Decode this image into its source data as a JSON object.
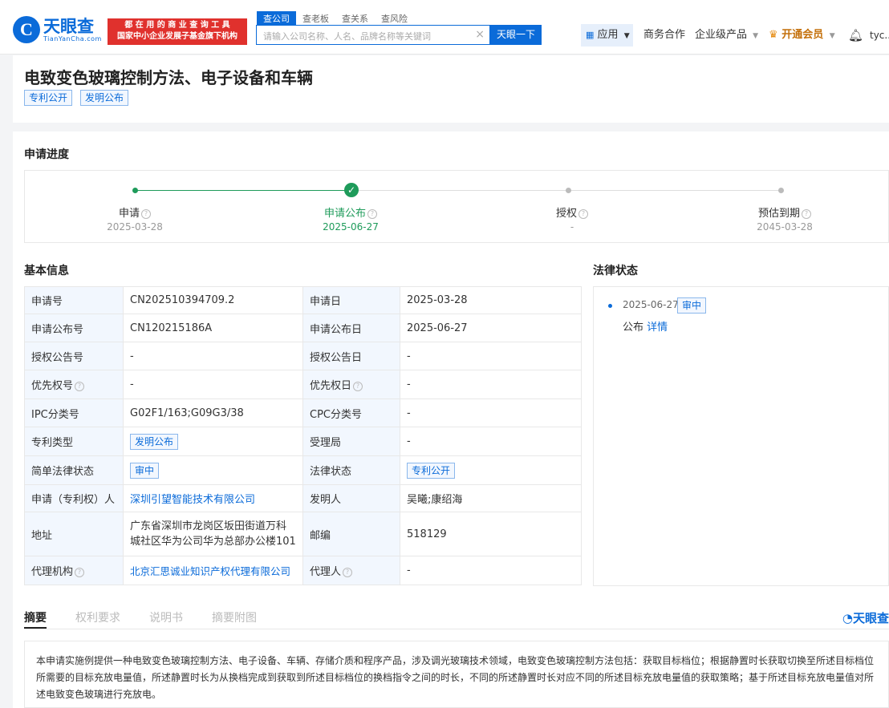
{
  "header": {
    "logo_glyph": "C",
    "logo_cn": "天眼查",
    "logo_en": "TianYanCha.com",
    "banner_line1": "都 在 用 的 商 业 查 询 工 具",
    "banner_line2": "国家中小企业发展子基金旗下机构",
    "search_tabs": [
      "查公司",
      "查老板",
      "查关系",
      "查风险"
    ],
    "search_placeholder": "请输入公司名称、人名、品牌名称等关键词",
    "search_clear": "×",
    "search_button": "天眼一下",
    "nav_app": "应用",
    "nav_biz": "商务合作",
    "nav_ent": "企业级产品",
    "nav_vip": "开通会员",
    "nav_user": "tyc..."
  },
  "patent": {
    "title": "电致变色玻璃控制方法、电子设备和车辆",
    "tags": [
      "专利公开",
      "发明公布"
    ]
  },
  "progress": {
    "title": "申请进度",
    "steps": [
      {
        "label": "申请",
        "date": "2025-03-28"
      },
      {
        "label": "申请公布",
        "date": "2025-06-27"
      },
      {
        "label": "授权",
        "date": "-"
      },
      {
        "label": "预估到期",
        "date": "2045-03-28"
      }
    ]
  },
  "basic": {
    "title": "基本信息",
    "rows": [
      {
        "k1": "申请号",
        "v1": "CN202510394709.2",
        "k2": "申请日",
        "v2": "2025-03-28"
      },
      {
        "k1": "申请公布号",
        "v1": "CN120215186A",
        "k2": "申请公布日",
        "v2": "2025-06-27"
      },
      {
        "k1": "授权公告号",
        "v1": "-",
        "k2": "授权公告日",
        "v2": "-"
      },
      {
        "k1": "优先权号",
        "v1": "-",
        "k2": "优先权日",
        "v2": "-"
      },
      {
        "k1": "IPC分类号",
        "v1": "G02F1/163;G09G3/38",
        "k2": "CPC分类号",
        "v2": "-"
      },
      {
        "k1": "专利类型",
        "v1": "发明公布",
        "k2": "受理局",
        "v2": "-"
      },
      {
        "k1": "简单法律状态",
        "v1": "审中",
        "k2": "法律状态",
        "v2": "专利公开"
      },
      {
        "k1": "申请（专利权）人",
        "v1": "深圳引望智能技术有限公司",
        "k2": "发明人",
        "v2": "吴曦;康绍海"
      },
      {
        "k1": "地址",
        "v1": "广东省深圳市龙岗区坂田街道万科城社区华为公司华为总部办公楼101",
        "k2": "邮编",
        "v2": "518129"
      },
      {
        "k1": "代理机构",
        "v1": "北京汇思诚业知识产权代理有限公司",
        "k2": "代理人",
        "v2": "-"
      }
    ]
  },
  "legal": {
    "title": "法律状态",
    "date": "2025-06-27",
    "tag": "审中",
    "desc": "公布",
    "link": "详情"
  },
  "tabs": [
    "摘要",
    "权利要求",
    "说明书",
    "摘要附图"
  ],
  "watermark": "天眼查",
  "abstract": "本申请实施例提供一种电致变色玻璃控制方法、电子设备、车辆、存储介质和程序产品，涉及调光玻璃技术领域，电致变色玻璃控制方法包括：获取目标档位；根据静置时长获取切换至所述目标档位所需要的目标充放电量值，所述静置时长为从换档完成到获取到所述目标档位的换档指令之间的时长，不同的所述静置时长对应不同的所述目标充放电量值的获取策略；基于所述目标充放电量值对所述电致变色玻璃进行充放电。"
}
